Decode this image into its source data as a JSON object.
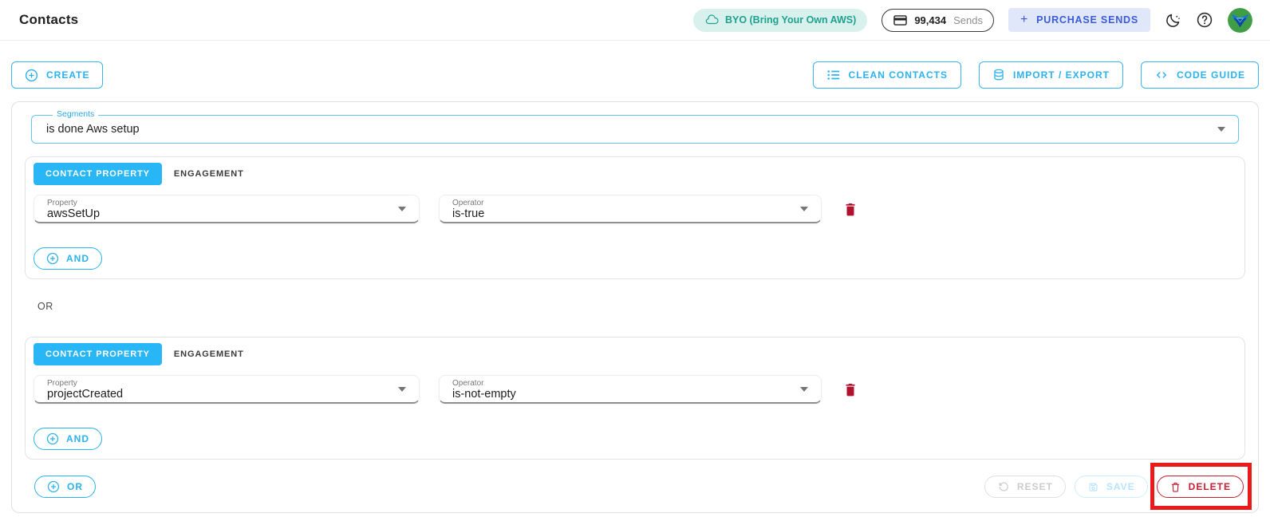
{
  "title": "Contacts",
  "header": {
    "byo_badge": "BYO (Bring Your Own AWS)",
    "sends_count": "99,434",
    "sends_unit": "Sends",
    "purchase_plus": "+",
    "purchase_label": "PURCHASE SENDS"
  },
  "toolbar": {
    "create": "CREATE",
    "clean_contacts": "CLEAN CONTACTS",
    "import_export": "IMPORT / EXPORT",
    "code_guide": "CODE GUIDE"
  },
  "panel": {
    "segments": {
      "label": "Segments",
      "value": "is done Aws setup"
    },
    "or_separator": "OR",
    "groups": [
      {
        "tab_contact_property": "CONTACT PROPERTY",
        "tab_engagement": "ENGAGEMENT",
        "property_label": "Property",
        "property_value": "awsSetUp",
        "operator_label": "Operator",
        "operator_value": "is-true",
        "and_button": "AND"
      },
      {
        "tab_contact_property": "CONTACT PROPERTY",
        "tab_engagement": "ENGAGEMENT",
        "property_label": "Property",
        "property_value": "projectCreated",
        "operator_label": "Operator",
        "operator_value": "is-not-empty",
        "and_button": "AND"
      }
    ],
    "footer": {
      "or_button": "OR",
      "reset": "RESET",
      "save": "SAVE",
      "delete": "DELETE"
    }
  },
  "colors": {
    "accent_cyan": "#29b3ef",
    "teal_badge": "#1fa18f",
    "purchase_blue": "#3a5bd9",
    "trash_red": "#b0122d",
    "delete_red": "#c51f33",
    "annotation_red": "#ea1a1a",
    "avatar_green": "#3f9e45"
  }
}
